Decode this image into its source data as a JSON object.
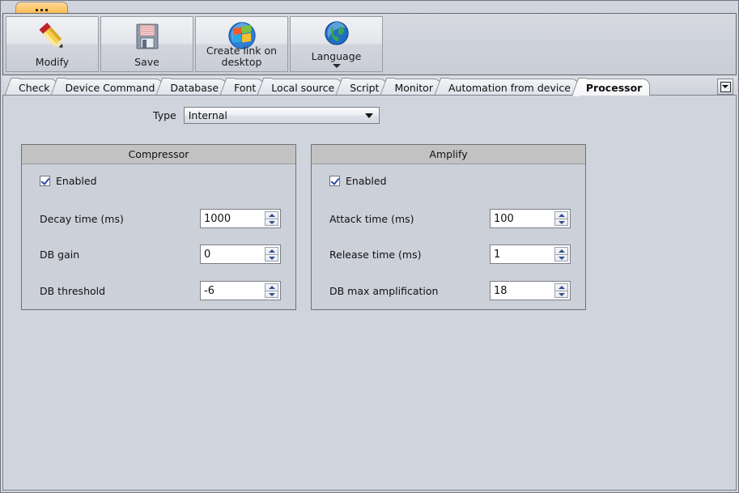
{
  "window": {
    "stub_tab_label": "...",
    "accent_orange": "#fec667",
    "background": "#d0d4dc",
    "panel_header": "#c2c2c2"
  },
  "toolbar": {
    "buttons": [
      {
        "label": "Modify",
        "icon": "pencil-icon",
        "has_caret": false,
        "overlap": false
      },
      {
        "label": "Save",
        "icon": "floppy-disk-icon",
        "has_caret": false,
        "overlap": false
      },
      {
        "label": "Create link on\ndesktop",
        "icon": "windows-logo-icon",
        "has_caret": false,
        "overlap": true
      },
      {
        "label": "Language",
        "icon": "globe-icon",
        "has_caret": true,
        "overlap": false
      }
    ]
  },
  "tabs": {
    "items": [
      {
        "label": "Check",
        "active": false
      },
      {
        "label": "Device Command",
        "active": false
      },
      {
        "label": "Database",
        "active": false
      },
      {
        "label": "Font",
        "active": false
      },
      {
        "label": "Local source",
        "active": false
      },
      {
        "label": "Script",
        "active": false
      },
      {
        "label": "Monitor",
        "active": false
      },
      {
        "label": "Automation from device",
        "active": false
      },
      {
        "label": "Processor",
        "active": true
      }
    ],
    "overflow_icon": "chevron-down-icon"
  },
  "main": {
    "type_row": {
      "label": "Type",
      "value": "Internal",
      "options": [
        "Internal"
      ]
    },
    "compressor": {
      "title": "Compressor",
      "enabled_label": "Enabled",
      "enabled_checked": true,
      "fields": [
        {
          "label": "Decay time (ms)",
          "value": "1000"
        },
        {
          "label": "DB gain",
          "value": "0"
        },
        {
          "label": "DB threshold",
          "value": "-6"
        }
      ]
    },
    "amplify": {
      "title": "Amplify",
      "enabled_label": "Enabled",
      "enabled_checked": true,
      "fields": [
        {
          "label": "Attack time (ms)",
          "value": "100"
        },
        {
          "label": "Release time (ms)",
          "value": "1"
        },
        {
          "label": "DB max amplification",
          "value": "18"
        }
      ]
    }
  }
}
